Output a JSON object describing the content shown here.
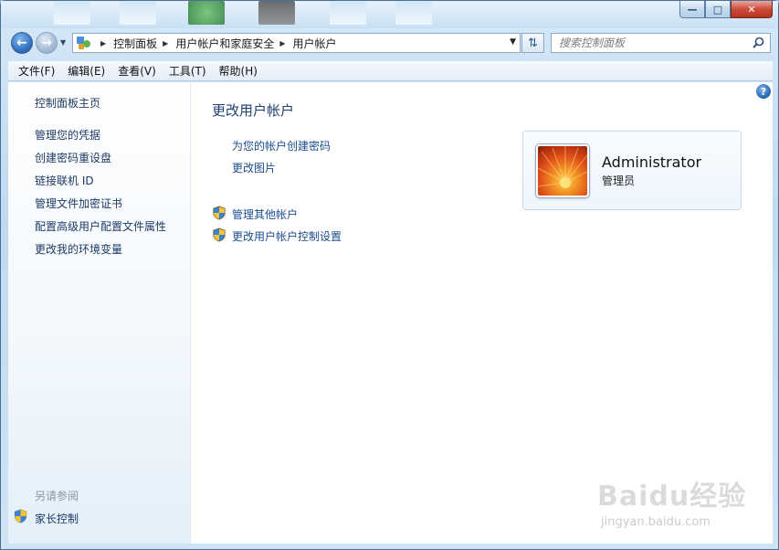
{
  "window": {
    "caption": {
      "minimize": "—",
      "maximize": "□",
      "close": "✕"
    }
  },
  "nav": {
    "breadcrumbs": [
      "控制面板",
      "用户帐户和家庭安全",
      "用户帐户"
    ],
    "search_placeholder": "搜索控制面板"
  },
  "menu": [
    "文件(F)",
    "编辑(E)",
    "查看(V)",
    "工具(T)",
    "帮助(H)"
  ],
  "sidebar": {
    "home": "控制面板主页",
    "items": [
      "管理您的凭据",
      "创建密码重设盘",
      "链接联机 ID",
      "管理文件加密证书",
      "配置高级用户配置文件属性",
      "更改我的环境变量"
    ],
    "see_also_title": "另请参阅",
    "see_also_items": [
      "家长控制"
    ]
  },
  "main": {
    "title": "更改用户帐户",
    "tasks": [
      "为您的帐户创建密码",
      "更改图片"
    ],
    "admin_tasks": [
      "管理其他帐户",
      "更改用户帐户控制设置"
    ]
  },
  "account": {
    "name": "Administrator",
    "role": "管理员"
  },
  "watermark": {
    "brand": "Baidu经验",
    "url": "jingyan.baidu.com"
  },
  "colors": {
    "link": "#1a4d8f",
    "title": "#1e3f6e",
    "frame": "#bfdaf0"
  }
}
